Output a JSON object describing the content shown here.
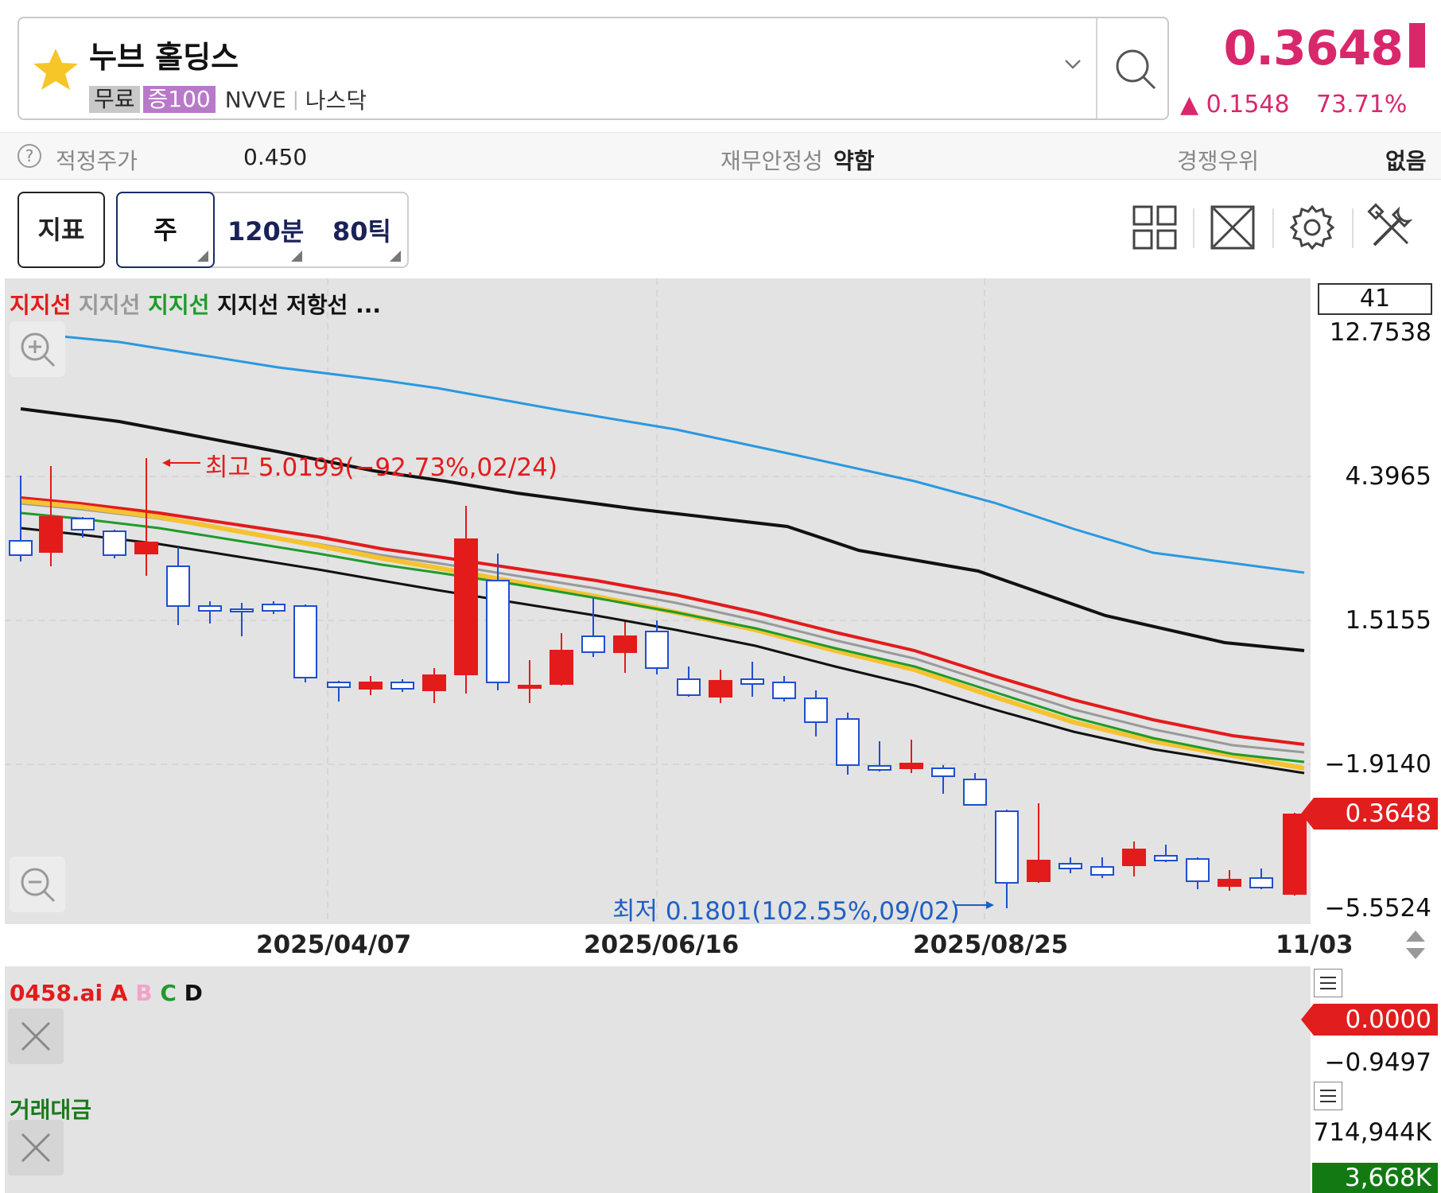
{
  "header": {
    "stock_name": "누브 홀딩스",
    "tag_free": "무료",
    "tag_margin": "증100",
    "ticker": "NVVE",
    "exchange": "나스닥",
    "price": "0.3648",
    "change": "▲ 0.1548",
    "change_pct": "73.71%",
    "star_icon": "star-icon",
    "search_icon": "search-icon"
  },
  "info": {
    "fair_price_label": "적정주가",
    "fair_price_value": "0.450",
    "stability_label": "재무안정성",
    "stability_value": "약함",
    "advantage_label": "경쟁우위",
    "advantage_value": "없음"
  },
  "toolbar": {
    "indicator_label": "지표",
    "period_active": "주",
    "period_120": "120분",
    "period_80": "80틱",
    "icons": [
      "layout-icon",
      "expand-icon",
      "settings-icon",
      "tools-icon"
    ]
  },
  "chart": {
    "legend": [
      {
        "text": "지지선",
        "color": "#e31b1b"
      },
      {
        "text": "지지선",
        "color": "#999999"
      },
      {
        "text": "지지선",
        "color": "#1f9b2a"
      },
      {
        "text": "지지선",
        "color": "#111111"
      },
      {
        "text": "저항선",
        "color": "#111111"
      },
      {
        "text": "...",
        "color": "#111111"
      }
    ],
    "count": "41",
    "y_labels": [
      "12.7538",
      "4.3965",
      "1.5155",
      "−1.9140",
      "−5.5524"
    ],
    "current_price_tag": "0.3648",
    "high_annotation": "최고 5.0199(−92.73%,02/24)",
    "low_annotation": "최저 0.1801(102.55%,09/02)",
    "x_labels": [
      "2025/04/07",
      "2025/06/16",
      "2025/08/25",
      "11/03"
    ],
    "colors": {
      "up": "#e31b1b",
      "down": "#1f4fd0",
      "ma_blue": "#2a98e0",
      "ma_yellow": "#f5c232"
    }
  },
  "indicator1": {
    "name": "0458.ai",
    "a": "A",
    "b": "B",
    "c": "C",
    "d": "D",
    "value_tag": "0.0000",
    "value2": "−0.9497"
  },
  "indicator2": {
    "name": "거래대금",
    "value1": "714,944K",
    "value_tag": "3,668K"
  },
  "chart_data": {
    "type": "candlestick",
    "x_range": [
      "2025/02/03",
      "2025/11/03"
    ],
    "y_axis_ticks": [
      12.7538,
      4.3965,
      1.5155,
      -1.914,
      -5.5524
    ],
    "high": {
      "value": 5.0199,
      "date": "02/24"
    },
    "low": {
      "value": 0.1801,
      "date": "09/02"
    },
    "last": 0.3648
  }
}
